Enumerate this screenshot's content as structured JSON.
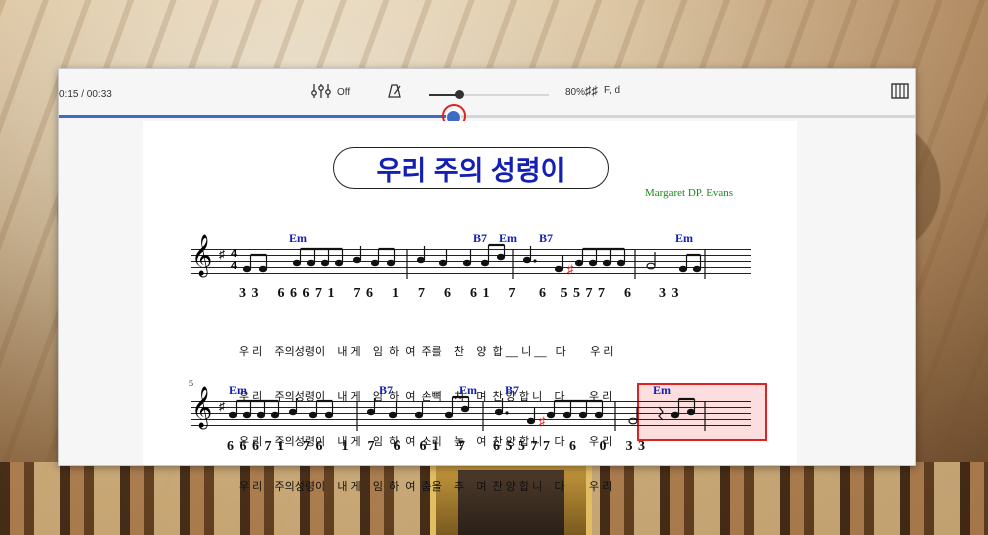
{
  "toolbar": {
    "time": "0:15 / 00:33",
    "mixer_label": "Off",
    "tempo_label": "80%",
    "tempo_fraction": 0.25,
    "key_label": "F, d",
    "playback_fraction": 0.46
  },
  "score": {
    "title": "우리 주의 성령이",
    "composer": "Margaret DP. Evans",
    "chords_line1": [
      "Em",
      "B7",
      "Em",
      "B7",
      "Em"
    ],
    "chords_line2": [
      "Em",
      "B7",
      "Em",
      "B7",
      "Em"
    ],
    "numbers_line1": "3 3    6 6 6 7 1    7 6    1    7    6    6 1    7     6   5 5 7 7    6      3 3",
    "lyrics": [
      "우 리    주의성령이    내 게    임  하  여  주를    찬    양  합 __ 니 __   다        우 리",
      "우 리    주의성령이    내 게    임  하  여  손뼉    치    며  찬 양 합 니    다        우 리",
      "우 리    주의성령이    내 게    임  하  여  소리    높    여  찬 양 합 니    다        우 리",
      "우 리    주의성령이    내 게    임  하  여  춤을    추    며  찬 양 합 니    다        우 리"
    ],
    "measure_number": "5",
    "numbers_line2": "6 6 6 7 1    7 6    1    7    6    6 1    7      6 5 5 7 7    6     0    3 3"
  },
  "colors": {
    "accent": "#3d6cc4",
    "title_blue": "#1420b4",
    "composer_green": "#1c8a1c",
    "highlight_red": "#dd2222"
  },
  "icons": {
    "mixer": "mixer-sliders-icon",
    "metronome": "metronome-icon",
    "key": "key-signature-icon",
    "piano": "piano-keyboard-icon"
  }
}
